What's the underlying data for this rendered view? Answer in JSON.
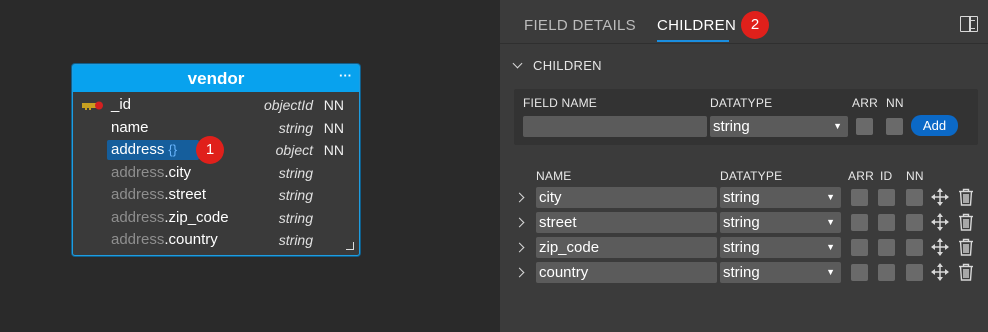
{
  "entity": {
    "title": "vendor",
    "more": "···",
    "fields": [
      {
        "prefix": "",
        "name": "_id",
        "type": "objectId",
        "nn": "NN",
        "key": true
      },
      {
        "prefix": "",
        "name": "name",
        "type": "string",
        "nn": "NN"
      },
      {
        "prefix": "",
        "name": "address",
        "brace": "{}",
        "type": "object",
        "nn": "NN",
        "selected": true
      },
      {
        "prefix": "address",
        "name": ".city",
        "type": "string",
        "nn": ""
      },
      {
        "prefix": "address",
        "name": ".street",
        "type": "string",
        "nn": ""
      },
      {
        "prefix": "address",
        "name": ".zip_code",
        "type": "string",
        "nn": ""
      },
      {
        "prefix": "address",
        "name": ".country",
        "type": "string",
        "nn": ""
      }
    ]
  },
  "badges": [
    "1",
    "2"
  ],
  "tabs": {
    "field_details": "FIELD DETAILS",
    "children": "CHILDREN"
  },
  "section": {
    "title": "CHILDREN"
  },
  "add_form": {
    "field_name_label": "FIELD NAME",
    "datatype_label": "DATATYPE",
    "arr_label": "ARR",
    "nn_label": "NN",
    "field_name_value": "",
    "datatype_value": "string",
    "add_label": "Add"
  },
  "children_table": {
    "headers": {
      "name": "NAME",
      "datatype": "DATATYPE",
      "arr": "ARR",
      "id": "ID",
      "nn": "NN"
    },
    "rows": [
      {
        "name": "city",
        "datatype": "string"
      },
      {
        "name": "street",
        "datatype": "string"
      },
      {
        "name": "zip_code",
        "datatype": "string"
      },
      {
        "name": "country",
        "datatype": "string"
      }
    ]
  },
  "icons": {
    "key": "key-icon",
    "move": "move-icon",
    "delete": "trash-icon",
    "panel": "panel-toggle-icon"
  },
  "colors": {
    "accent": "#08a2ee",
    "badge": "#e0201b",
    "button": "#0b69c7"
  }
}
